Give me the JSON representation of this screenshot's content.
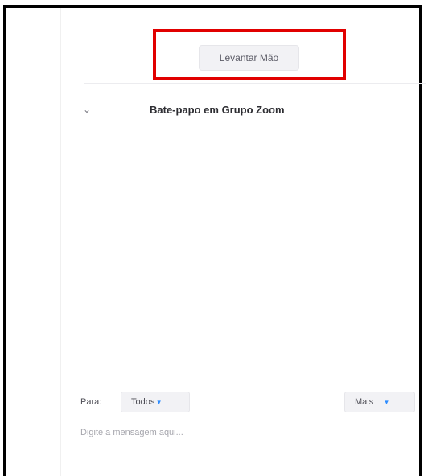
{
  "raise_hand": {
    "label": "Levantar Mão"
  },
  "chat": {
    "title": "Bate-papo em Grupo Zoom",
    "collapse_icon": "chevron-down-icon"
  },
  "composer": {
    "to_label": "Para:",
    "to_value": "Todos",
    "more_label": "Mais",
    "message_placeholder": "Digite a mensagem aqui...",
    "message_value": ""
  },
  "colors": {
    "highlight": "#e10000",
    "accent": "#2d8cff",
    "frame": "#000000"
  }
}
